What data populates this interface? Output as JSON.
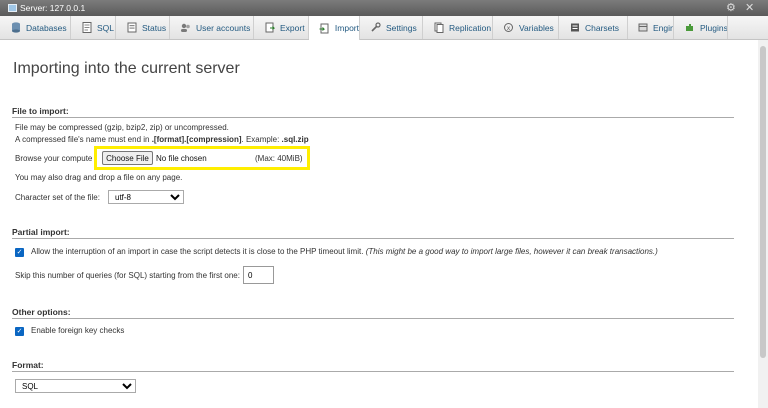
{
  "titlebar": {
    "server": "Server: 127.0.0.1"
  },
  "tabs": [
    {
      "label": "Databases",
      "icon": "databases-icon"
    },
    {
      "label": "SQL",
      "icon": "sql-icon"
    },
    {
      "label": "Status",
      "icon": "status-icon"
    },
    {
      "label": "User accounts",
      "icon": "user-accounts-icon"
    },
    {
      "label": "Export",
      "icon": "export-icon"
    },
    {
      "label": "Import",
      "icon": "import-icon",
      "active": true
    },
    {
      "label": "Settings",
      "icon": "settings-icon"
    },
    {
      "label": "Replication",
      "icon": "replication-icon"
    },
    {
      "label": "Variables",
      "icon": "variables-icon"
    },
    {
      "label": "Charsets",
      "icon": "charsets-icon"
    },
    {
      "label": "Engines",
      "icon": "engines-icon"
    },
    {
      "label": "Plugins",
      "icon": "plugins-icon"
    }
  ],
  "page_title": "Importing into the current server",
  "file_to_import": {
    "heading": "File to import:",
    "compress_note": "File may be compressed (gzip, bzip2, zip) or uncompressed.",
    "name_note_prefix": "A compressed file's name must end in ",
    "name_note_format": ".[format].[compression]",
    "name_note_mid": ". Example: ",
    "name_note_example": ".sql.zip",
    "browse_label": "Browse your compute",
    "choose_button": "Choose File",
    "no_file": "No file chosen",
    "max_size": "(Max: 40MiB)",
    "drag_note": "You may also drag and drop a file on any page.",
    "charset_label": "Character set of the file:",
    "charset_value": "utf-8"
  },
  "partial_import": {
    "heading": "Partial import:",
    "allow_interrupt": "Allow the interruption of an import in case the script detects it is close to the PHP timeout limit.",
    "allow_interrupt_note": "(This might be a good way to import large files, however it can break transactions.)",
    "allow_interrupt_checked": true,
    "skip_label": "Skip this number of queries (for SQL) starting from the first one:",
    "skip_value": "0"
  },
  "other_options": {
    "heading": "Other options:",
    "foreign_keys": "Enable foreign key checks",
    "foreign_keys_checked": true
  },
  "format": {
    "heading": "Format:",
    "value": "SQL"
  },
  "colors": {
    "highlight": "#ffee00",
    "link": "#235a81",
    "checkbox": "#0a66c2"
  }
}
